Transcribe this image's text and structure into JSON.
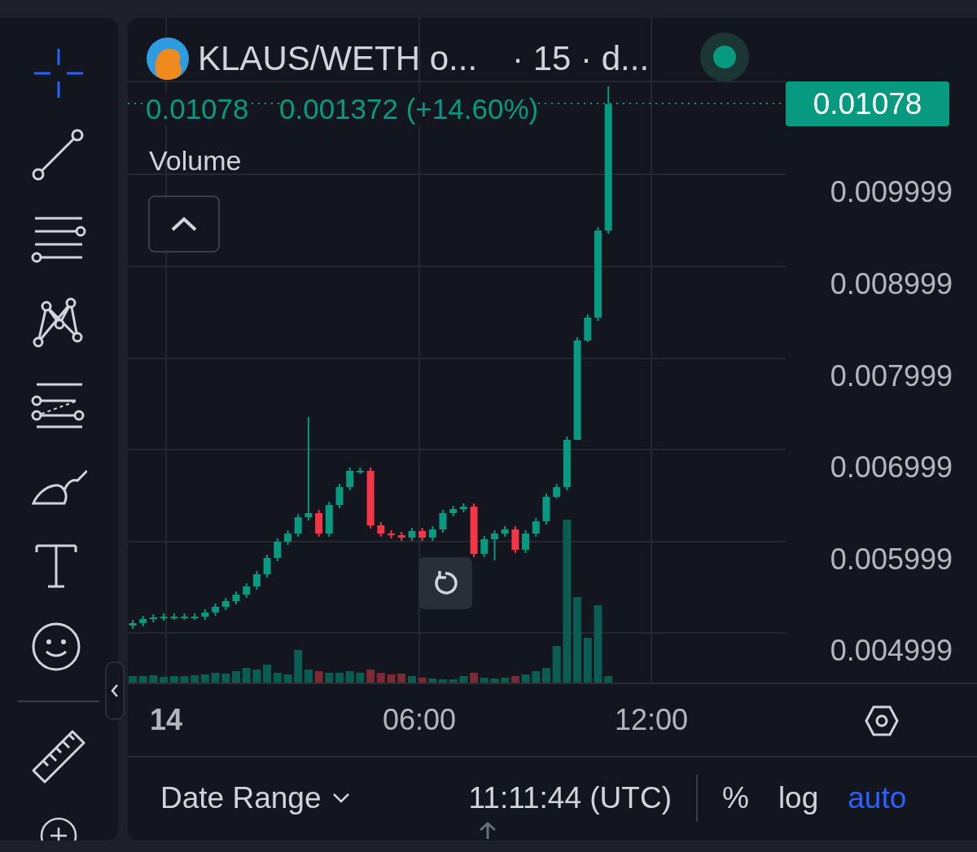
{
  "toolbar": {
    "tools": [
      {
        "kind": "crosshair",
        "selected": true
      },
      {
        "kind": "trend-line",
        "selected": false
      },
      {
        "kind": "fib",
        "selected": false
      },
      {
        "kind": "pattern",
        "selected": false
      },
      {
        "kind": "projection",
        "selected": false
      },
      {
        "kind": "brush",
        "selected": false
      },
      {
        "kind": "text",
        "selected": false
      },
      {
        "kind": "emoji",
        "selected": false
      },
      {
        "kind": "ruler",
        "selected": false
      },
      {
        "kind": "zoom",
        "selected": false
      }
    ]
  },
  "header": {
    "symbol": "KLAUS/WETH o...",
    "interval": "· 15 · d..."
  },
  "legend": {
    "price": "0.01078",
    "change": "0.001372 (+14.60%)",
    "indicator": "Volume"
  },
  "price_scale": {
    "labels": [
      "0.009999",
      "0.008999",
      "0.007999",
      "0.006999",
      "0.005999",
      "0.004999"
    ],
    "last_price": "0.01078"
  },
  "time_scale": {
    "labels": [
      {
        "text": "14",
        "bold": true
      },
      {
        "text": "06:00",
        "bold": false
      },
      {
        "text": "12:00",
        "bold": false
      }
    ]
  },
  "bottom_bar": {
    "date_range": "Date Range",
    "time": "11:11:44 (UTC)",
    "options": [
      {
        "label": "%",
        "selected": false
      },
      {
        "label": "log",
        "selected": false
      },
      {
        "label": "auto",
        "selected": true
      }
    ]
  }
}
